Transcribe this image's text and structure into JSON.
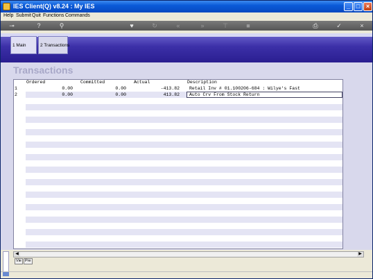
{
  "window": {
    "title": "IES Client(Q) v8.24 : My IES",
    "controls": [
      {
        "name": "minimize-button",
        "glyph": "_"
      },
      {
        "name": "maximize-button",
        "glyph": "□"
      },
      {
        "name": "close-button",
        "glyph": "×"
      }
    ]
  },
  "menu": {
    "items": [
      "Help",
      "Submit",
      "Quit",
      "Functions",
      "Commands"
    ]
  },
  "toolbar": {
    "icons": [
      "key-icon",
      "help-icon",
      "search-icon",
      "heart-icon",
      "refresh-icon",
      "rewind-icon",
      "fast-forward-icon",
      "divider-icon",
      "stop-icon",
      "printer-icon",
      "check-icon",
      "close-icon"
    ]
  },
  "tabs": {
    "main_label": "1 Main",
    "transactions_label": "2 Transactions"
  },
  "page": {
    "title": "Transactions"
  },
  "grid": {
    "columns": [
      "Ordered",
      "Committed",
      "Actual",
      "Description"
    ],
    "rows": [
      {
        "num": "1",
        "ordered": "0.00",
        "committed": "0.00",
        "actual": "-413.82",
        "description": "Retail Inv # 01.100206-684 : Wilye's Fast"
      },
      {
        "num": "2",
        "ordered": "0.00",
        "committed": "0.00",
        "actual": "413.82",
        "description": "Auto Crv From Stock Return"
      }
    ]
  },
  "bottom_tabs": {
    "view_label": "Vie",
    "pre_label": "Pre"
  },
  "colors": {
    "accent": "#3c30a8",
    "titlebar": "#0a5ad8",
    "stripe": "#e4e4f4"
  }
}
